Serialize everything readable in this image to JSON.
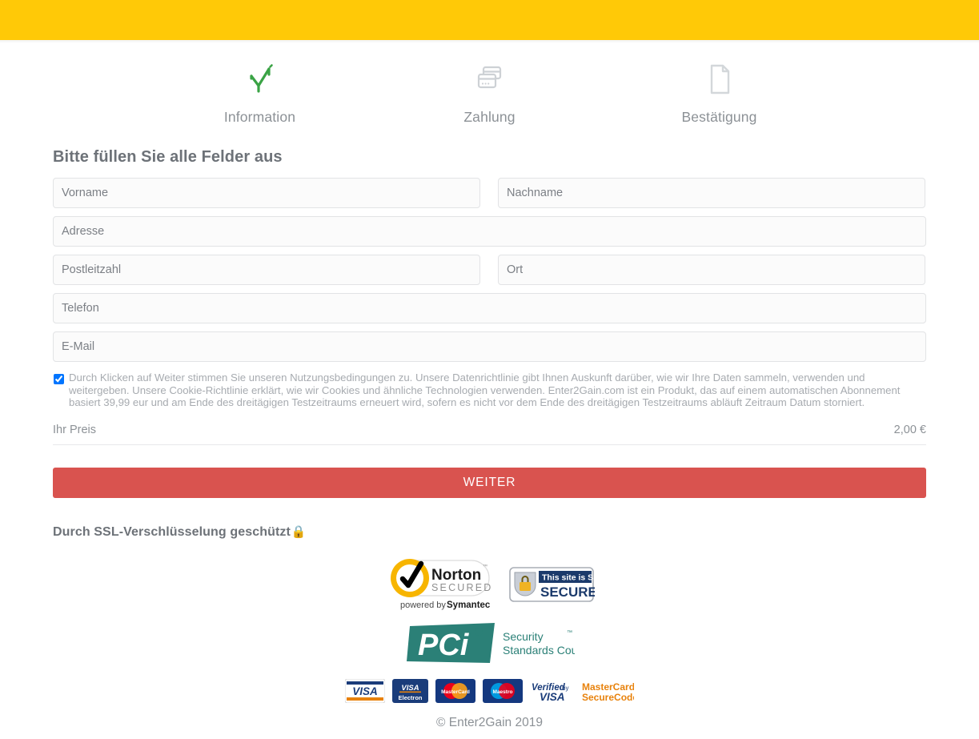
{
  "theme": {
    "header_yellow": "#ffc907",
    "button_red": "#d9534f",
    "check_green": "#3aa345",
    "muted_text": "#8c9196",
    "heading_text": "#6d7278",
    "field_border": "#e2e3e5",
    "field_bg": "#fbfbfb"
  },
  "steps": [
    {
      "label": "Information",
      "icon": "check-icon",
      "state": "complete"
    },
    {
      "label": "Zahlung",
      "icon": "credit-cards-icon",
      "state": "pending"
    },
    {
      "label": "Bestätigung",
      "icon": "document-icon",
      "state": "pending"
    }
  ],
  "form": {
    "heading": "Bitte füllen Sie alle Felder aus",
    "fields": [
      {
        "name": "vorname",
        "placeholder": "Vorname",
        "value": "",
        "width": "half"
      },
      {
        "name": "nachname",
        "placeholder": "Nachname",
        "value": "",
        "width": "half"
      },
      {
        "name": "adresse",
        "placeholder": "Adresse",
        "value": "",
        "width": "full"
      },
      {
        "name": "postleitzahl",
        "placeholder": "Postleitzahl",
        "value": "",
        "width": "half"
      },
      {
        "name": "ort",
        "placeholder": "Ort",
        "value": "",
        "width": "half"
      },
      {
        "name": "telefon",
        "placeholder": "Telefon",
        "value": "",
        "width": "full"
      },
      {
        "name": "email",
        "placeholder": "E-Mail",
        "value": "",
        "width": "full"
      }
    ]
  },
  "terms": {
    "checked": true,
    "text": "Durch Klicken auf Weiter stimmen Sie unseren Nutzungsbedingungen zu. Unsere Datenrichtlinie gibt Ihnen Auskunft darüber, wie wir Ihre Daten sammeln, verwenden und weitergeben. Unsere Cookie-Richtlinie erklärt, wie wir Cookies und ähnliche Technologien verwenden. Enter2Gain.com ist ein Produkt, das auf einem automatischen Abonnement basiert 39,99 eur und am Ende des dreitägigen Testzeitraums erneuert wird, sofern es nicht vor dem Ende des dreitägigen Testzeitraums abläuft Zeitraum Datum storniert."
  },
  "price": {
    "label": "Ihr Preis",
    "amount": "2,00 €"
  },
  "submit": {
    "label": "WEITER"
  },
  "ssl": {
    "text": "Durch SSL-Verschlüsselung geschützt",
    "lock_glyph": "🔒"
  },
  "badges": {
    "norton": {
      "name": "Norton",
      "secured": "SECURED",
      "powered_by": "powered by",
      "brand": "Symantec",
      "tm": "™"
    },
    "ssl_seal": {
      "line1": "This site is SSL",
      "line2": "SECURED"
    },
    "pci": {
      "mark": "PCI",
      "line1": "Security",
      "line2": "Standards Council",
      "tm": "™"
    },
    "cards": [
      {
        "name": "visa",
        "text": "VISA",
        "sub": ""
      },
      {
        "name": "visa-electron",
        "text": "VISA",
        "sub": "Electron"
      },
      {
        "name": "mastercard",
        "text": "MasterCard",
        "sub": ""
      },
      {
        "name": "maestro",
        "text": "Maestro",
        "sub": ""
      },
      {
        "name": "verified-by-visa",
        "text": "Verified by",
        "sub": "VISA"
      },
      {
        "name": "mastercard-securecode",
        "text": "MasterCard",
        "sub": "SecureCode"
      }
    ]
  },
  "footer": {
    "copyright": "© Enter2Gain 2019"
  }
}
